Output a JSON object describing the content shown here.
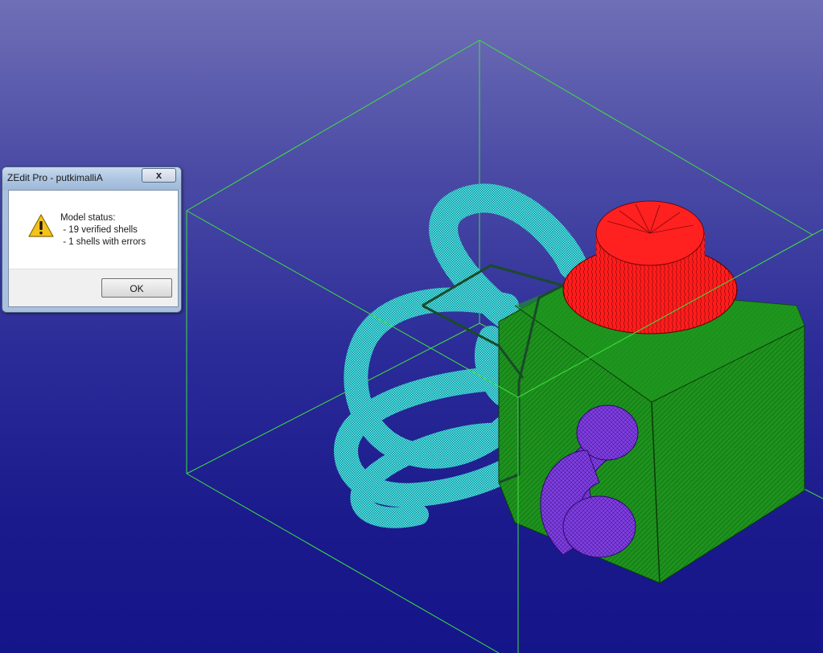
{
  "dialog": {
    "title": "ZEdit Pro - putkimalliA",
    "close_label": "x",
    "message_heading": "Model status:",
    "message_lines": [
      " - 19 verified shells",
      " - 1 shells with errors"
    ],
    "ok_label": "OK",
    "icon": "warning-icon"
  },
  "viewport": {
    "background_top": "#6f6fb6",
    "background_bottom": "#15158a",
    "bounding_box_color": "#40e040",
    "shell_colors": {
      "pipes": "#40e0e0",
      "body": "#1a8a1a",
      "cap": "#ff1a1a",
      "elbow": "#7a3ad8"
    }
  }
}
